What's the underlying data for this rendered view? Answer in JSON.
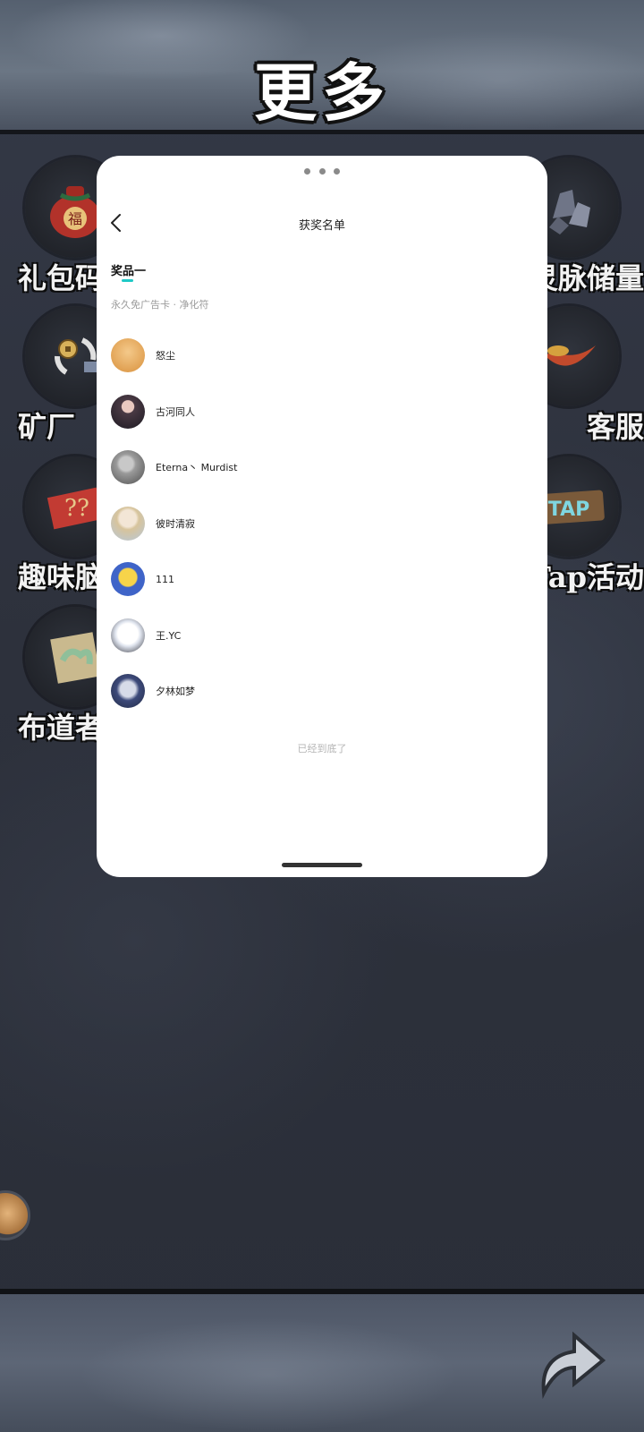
{
  "background": {
    "title": "更多",
    "menu": {
      "left": [
        {
          "label": "礼包码",
          "icon": "lucky-bag-icon"
        },
        {
          "label": "矿厂",
          "icon": "coin-exchange-icon"
        },
        {
          "label": "趣味脑",
          "icon": "scroll-puzzle-icon"
        },
        {
          "label": "布道者",
          "icon": "scroll-cloud-icon"
        }
      ],
      "right": [
        {
          "label": "灵脉储量",
          "icon": "ore-icon"
        },
        {
          "label": "客服",
          "icon": "pepper-icon"
        },
        {
          "label": "Tap活动",
          "icon": "tap-sign-icon"
        }
      ],
      "tap_sign_text": "TAP"
    }
  },
  "sheet": {
    "title": "获奖名单",
    "tab": "奖品一",
    "prize_desc": "永久免广告卡 · 净化符",
    "winners": [
      {
        "name": "怒尘",
        "avatar_colors": [
          "#f4c98a",
          "#d9913d"
        ]
      },
      {
        "name": "古河同人",
        "avatar_colors": [
          "#4a3a44",
          "#1d1a22"
        ]
      },
      {
        "name": "Eterna丶 Murdist",
        "avatar_colors": [
          "#9a9a9a",
          "#4f4f4f"
        ]
      },
      {
        "name": "彼时清寂",
        "avatar_colors": [
          "#f3e6d6",
          "#b7c7da"
        ]
      },
      {
        "name": "111",
        "avatar_colors": [
          "#f7d44a",
          "#3f64c8"
        ]
      },
      {
        "name": "王.YC",
        "avatar_colors": [
          "#ffffff",
          "#2c2c34"
        ]
      },
      {
        "name": "夕林如梦",
        "avatar_colors": [
          "#d7dbe8",
          "#3d4a7a"
        ]
      }
    ],
    "end_text": "已经到底了"
  },
  "colors": {
    "accent": "#1fc9c6"
  }
}
